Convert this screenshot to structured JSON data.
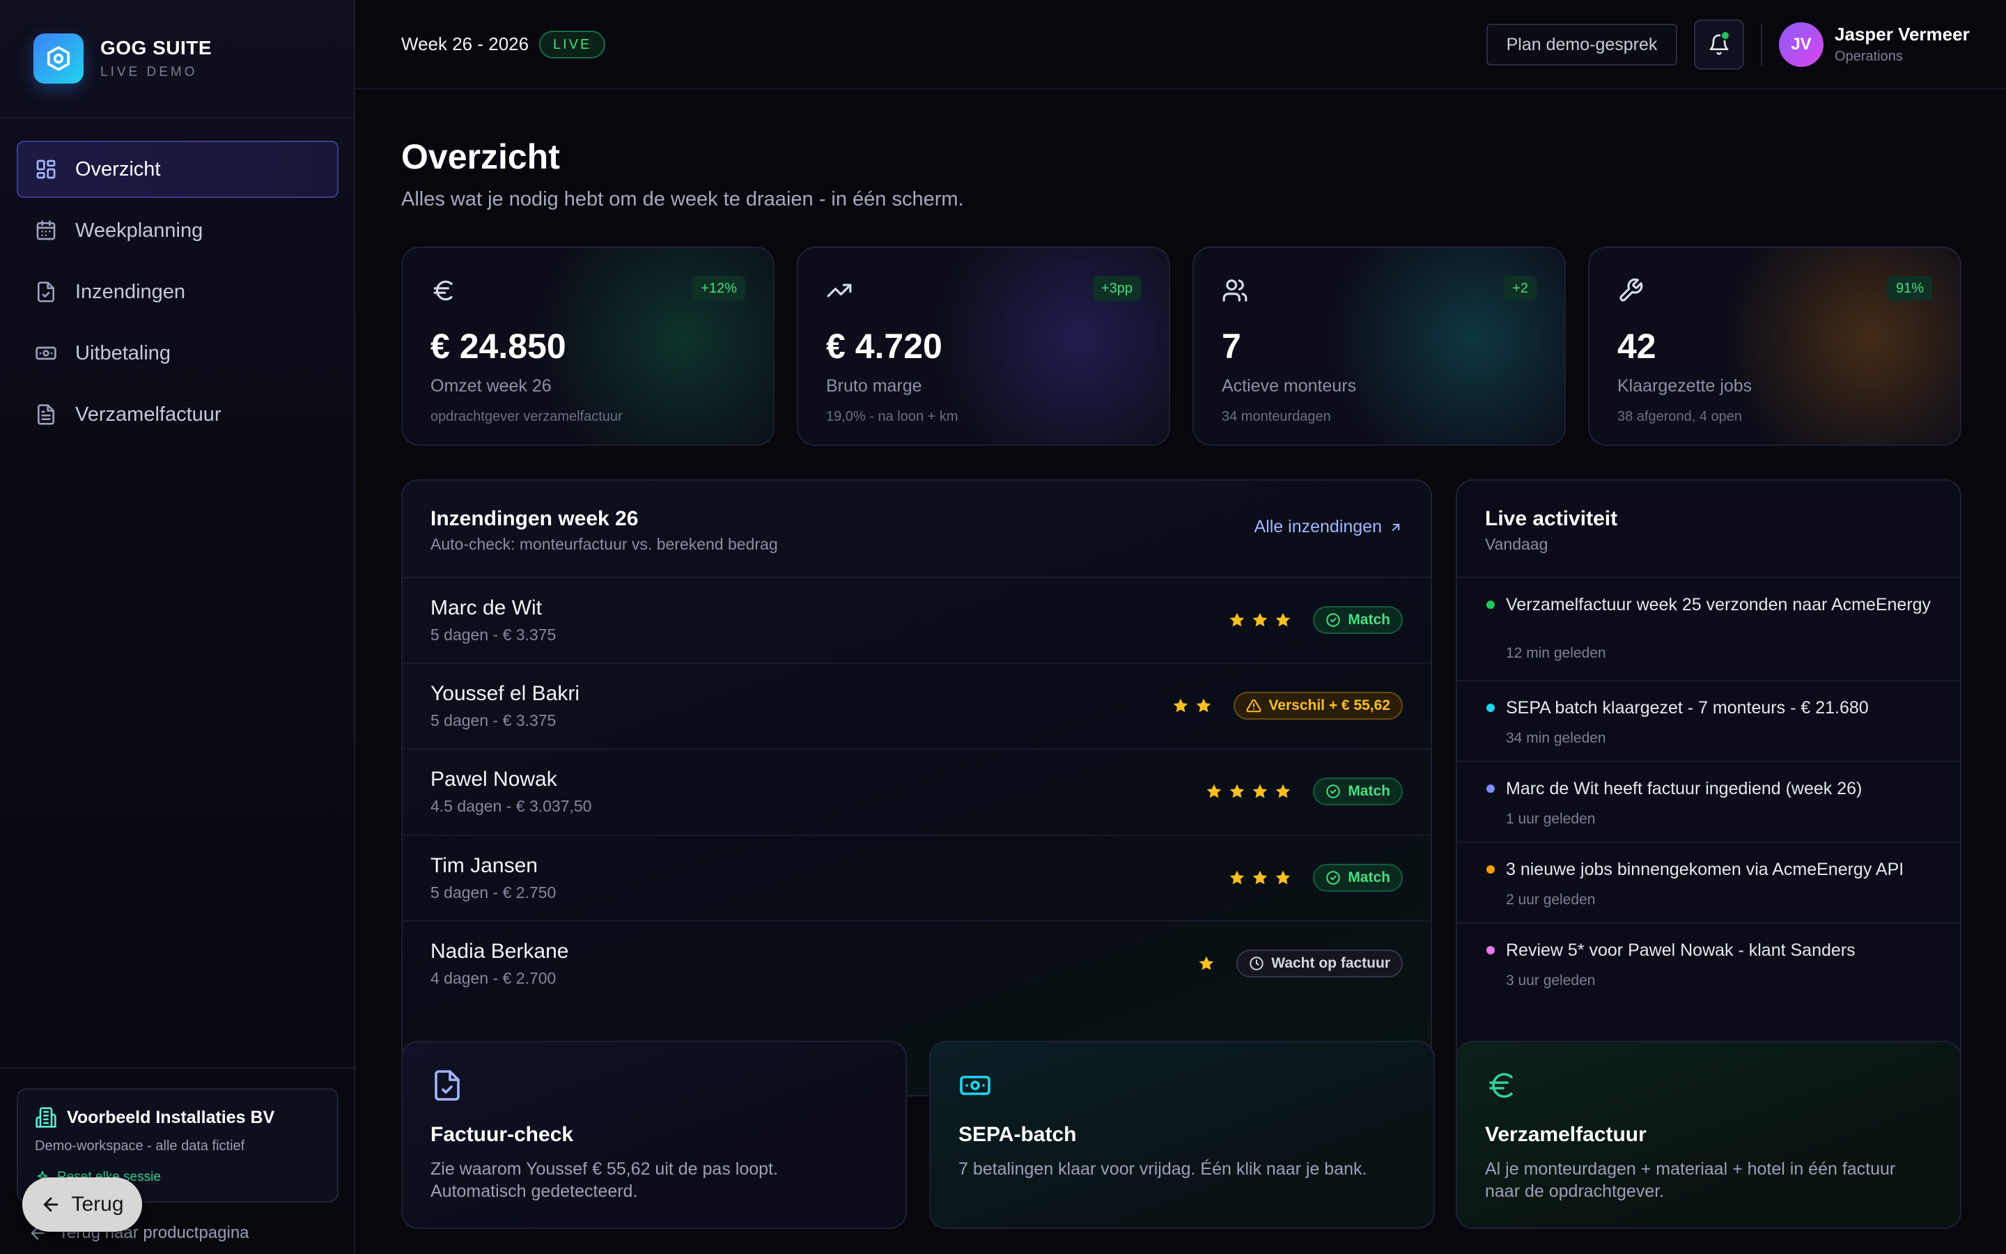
{
  "brand": {
    "title": "GOG SUITE",
    "subtitle": "LIVE DEMO"
  },
  "nav": {
    "items": [
      {
        "label": "Overzicht",
        "icon": "dashboard-icon",
        "active": true
      },
      {
        "label": "Weekplanning",
        "icon": "calendar-icon",
        "active": false
      },
      {
        "label": "Inzendingen",
        "icon": "file-check-icon",
        "active": false
      },
      {
        "label": "Uitbetaling",
        "icon": "banknote-icon",
        "active": false
      },
      {
        "label": "Verzamelfactuur",
        "icon": "document-icon",
        "active": false
      }
    ]
  },
  "workspace": {
    "name": "Voorbeeld Installaties BV",
    "description": "Demo-workspace - alle data fictief",
    "reset": "Reset elke sessie"
  },
  "back_link": "Terug naar productpagina",
  "back_button": "Terug",
  "topbar": {
    "week": "Week 26 - 2026",
    "live": "LIVE",
    "plan_button": "Plan demo-gesprek",
    "user_initials": "JV",
    "user_name": "Jasper Vermeer",
    "user_role": "Operations"
  },
  "page": {
    "title": "Overzicht",
    "subtitle": "Alles wat je nodig hebt om de week te draaien - in één scherm."
  },
  "stats": [
    {
      "icon": "euro-icon",
      "badge": "+12%",
      "value": "€ 24.850",
      "label": "Omzet week 26",
      "note": "opdrachtgever verzamelfactuur",
      "glow": "#0f3a2a"
    },
    {
      "icon": "trending-up-icon",
      "badge": "+3pp",
      "value": "€ 4.720",
      "label": "Bruto marge",
      "note": "19,0% - na loon + km",
      "glow": "#1c1b4a"
    },
    {
      "icon": "users-icon",
      "badge": "+2",
      "value": "7",
      "label": "Actieve monteurs",
      "note": "34 monteurdagen",
      "glow": "#0d3338"
    },
    {
      "icon": "wrench-icon",
      "badge": "91%",
      "value": "42",
      "label": "Klaargezette jobs",
      "note": "38 afgerond, 4 open",
      "glow": "#3a2810"
    }
  ],
  "submissions": {
    "title": "Inzendingen week 26",
    "subtitle": "Auto-check: monteurfactuur vs. berekend bedrag",
    "link": "Alle inzendingen",
    "rows": [
      {
        "name": "Marc de Wit",
        "meta": "5 dagen - € 3.375",
        "stars": 3,
        "status": "Match",
        "kind": "match"
      },
      {
        "name": "Youssef el Bakri",
        "meta": "5 dagen - € 3.375",
        "stars": 2,
        "status": "Verschil + € 55,62",
        "kind": "warn"
      },
      {
        "name": "Pawel Nowak",
        "meta": "4.5 dagen - € 3.037,50",
        "stars": 4,
        "status": "Match",
        "kind": "match"
      },
      {
        "name": "Tim Jansen",
        "meta": "5 dagen - € 2.750",
        "stars": 3,
        "status": "Match",
        "kind": "match"
      },
      {
        "name": "Nadia Berkane",
        "meta": "4 dagen - € 2.700",
        "stars": 1,
        "status": "Wacht op factuur",
        "kind": "wait"
      }
    ]
  },
  "activity": {
    "title": "Live activiteit",
    "subtitle": "Vandaag",
    "items": [
      {
        "text": "Verzamelfactuur week 25 verzonden naar AcmeEnergy",
        "time": "12 min geleden",
        "color": "#22c55e"
      },
      {
        "text": "SEPA batch klaargezet - 7 monteurs - € 21.680",
        "time": "34 min geleden",
        "color": "#22d3ee"
      },
      {
        "text": "Marc de Wit heeft factuur ingediend (week 26)",
        "time": "1 uur geleden",
        "color": "#818cf8"
      },
      {
        "text": "3 nieuwe jobs binnengekomen via AcmeEnergy API",
        "time": "2 uur geleden",
        "color": "#f59e0b"
      },
      {
        "text": "Review 5* voor Pawel Nowak - klant Sanders",
        "time": "3 uur geleden",
        "color": "#e879f9"
      }
    ]
  },
  "features": [
    {
      "icon": "file-check-icon",
      "title": "Factuur-check",
      "desc": "Zie waarom Youssef € 55,62 uit de pas loopt. Automatisch gedetecteerd.",
      "color": "#a5b4fc"
    },
    {
      "icon": "banknote-icon",
      "title": "SEPA-batch",
      "desc": "7 betalingen klaar voor vrijdag. Één klik naar je bank.",
      "color": "#22d3ee"
    },
    {
      "icon": "euro-icon",
      "title": "Verzamelfactuur",
      "desc": "Al je monteurdagen + materiaal + hotel in één factuur naar de opdrachtgever.",
      "color": "#34d399"
    }
  ]
}
